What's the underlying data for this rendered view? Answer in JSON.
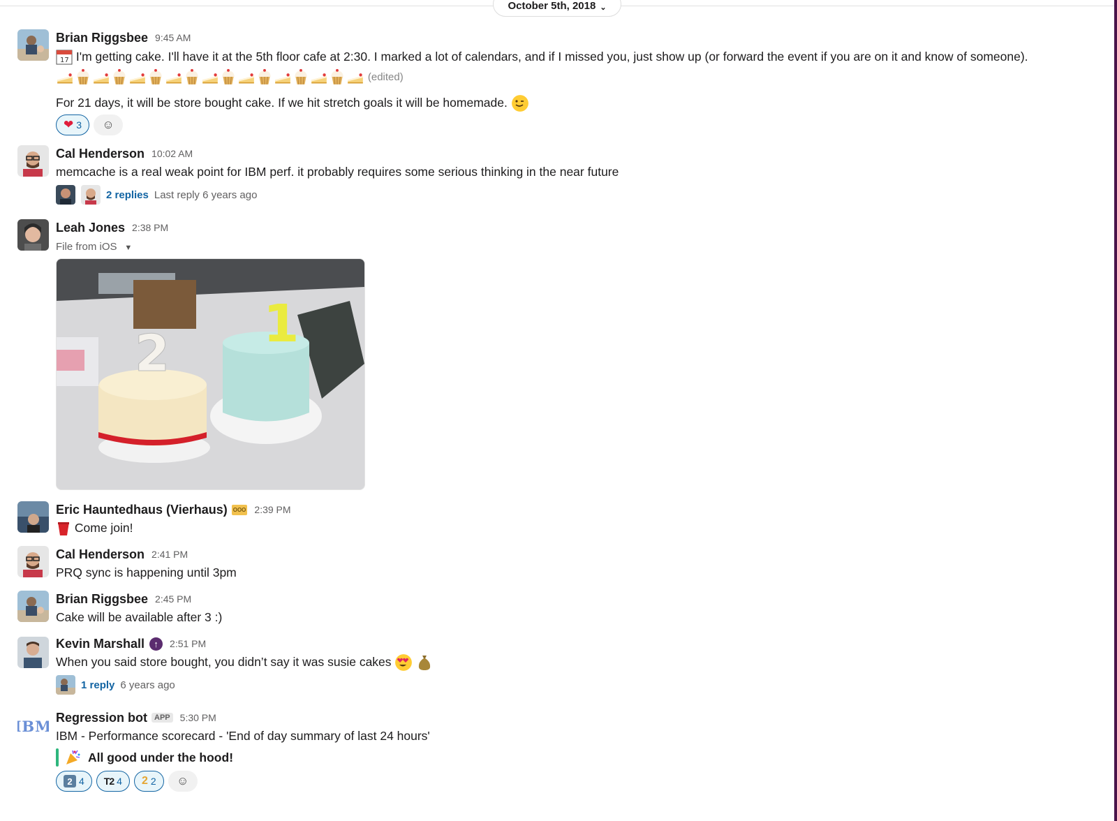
{
  "date_divider": {
    "label": "October 5th, 2018"
  },
  "messages": [
    {
      "name": "Brian Riggsbee",
      "time": "9:45 AM",
      "line1": "I'm getting cake. I'll have it at the 5th floor cafe at 2:30. I marked a lot of calendars, and if I missed you, just show up (or forward the event if you are on it and know of someone).",
      "edited": "(edited)",
      "line2": "For 21 days, it will be store bought cake. If we hit stretch goals it will be homemade.",
      "reaction_count": "3"
    },
    {
      "name": "Cal Henderson",
      "time": "10:02 AM",
      "text": "memcache is a real weak point for IBM perf. it probably requires some serious thinking in the near future",
      "replies": "2 replies",
      "last_reply": "Last reply 6 years ago"
    },
    {
      "name": "Leah Jones",
      "time": "2:38 PM",
      "file_caption": "File from iOS",
      "photo_numbers": [
        "2",
        "1"
      ]
    },
    {
      "name": "Eric Hauntedhaus (Vierhaus)",
      "status_badge": "OOO",
      "time": "2:39 PM",
      "text": "Come join!"
    },
    {
      "name": "Cal Henderson",
      "time": "2:41 PM",
      "text": "PRQ sync is happening until 3pm"
    },
    {
      "name": "Brian Riggsbee",
      "time": "2:45 PM",
      "text": "Cake will be available after 3 :)"
    },
    {
      "name": "Kevin Marshall",
      "time": "2:51 PM",
      "text": "When you said store bought, you didn’t say it was susie cakes",
      "replies": "1 reply",
      "last_reply": "6 years ago"
    },
    {
      "name": "Regression bot",
      "app_badge": "APP",
      "time": "5:30 PM",
      "avatar_text": "IBM",
      "text": "IBM - Performance scorecard - 'End of day summary of last 24 hours'",
      "attachment": "All good under the hood!",
      "reactions": [
        {
          "glyph": "2",
          "count": "4"
        },
        {
          "glyph": "T2",
          "count": "4"
        },
        {
          "glyph": "2",
          "count": "2"
        }
      ]
    }
  ],
  "icons": {
    "calendar": "calendar-icon",
    "cake": "cake-icon",
    "cupcake": "cupcake-icon",
    "wink": "wink-emoji-icon",
    "heart": "heart-icon",
    "add_reaction": "add-reaction-icon",
    "cup": "red-cup-icon",
    "heart_eyes": "heart-eyes-emoji-icon",
    "money_bag": "money-bag-icon",
    "tada": "tada-icon",
    "boost": "boost-icon"
  },
  "colors": {
    "link": "#1264a3",
    "reaction_bg": "#e8f5fa",
    "sidebar": "#4a154b",
    "attachment_bar": "#2eb67d"
  }
}
